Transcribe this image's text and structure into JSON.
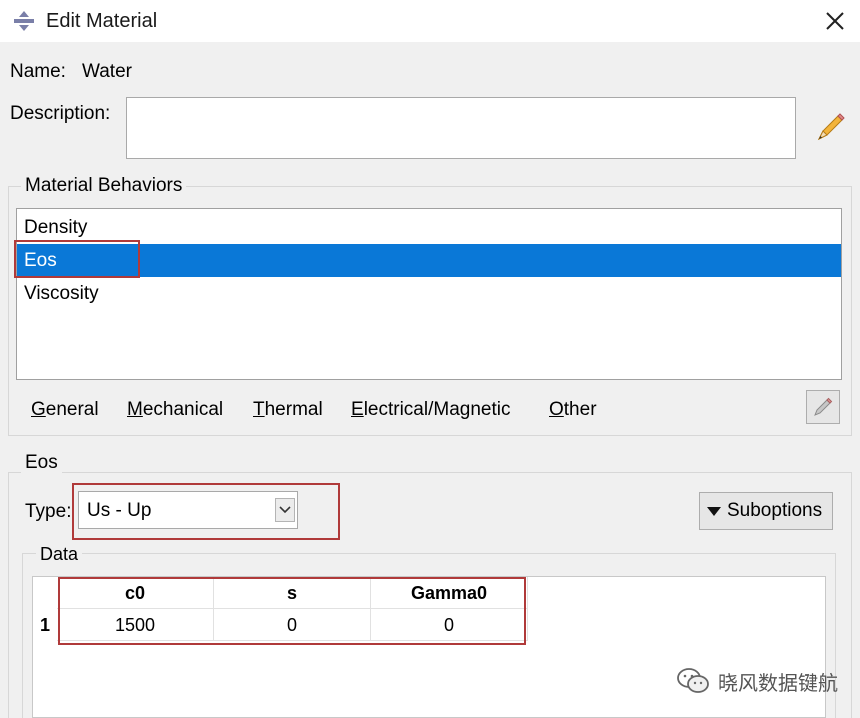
{
  "window": {
    "title": "Edit Material",
    "icon": "material-icon"
  },
  "name": {
    "label": "Name:",
    "value": "Water"
  },
  "description": {
    "label": "Description:",
    "value": ""
  },
  "material_behaviors": {
    "title": "Material Behaviors",
    "items": [
      "Density",
      "Eos",
      "Viscosity"
    ],
    "selected": "Eos"
  },
  "menus": [
    {
      "key": "G",
      "rest": "eneral"
    },
    {
      "key": "M",
      "rest": "echanical"
    },
    {
      "key": "T",
      "rest": "hermal"
    },
    {
      "key": "E",
      "rest": "lectrical/Magnetic"
    },
    {
      "key": "O",
      "rest": "ther"
    }
  ],
  "eos": {
    "title": "Eos",
    "type_label": "Type:",
    "type_value": "Us - Up",
    "suboptions_label": "Suboptions"
  },
  "data_table": {
    "title": "Data",
    "columns": [
      "c0",
      "s",
      "Gamma0"
    ],
    "rows": [
      {
        "index": "1",
        "cells": [
          "1500",
          "0",
          "0"
        ]
      }
    ]
  },
  "watermark": {
    "text": "晓风数据键航",
    "icon": "wechat-icon"
  },
  "colors": {
    "selection": "#0a78d7",
    "highlight_box": "#b03a3a"
  }
}
